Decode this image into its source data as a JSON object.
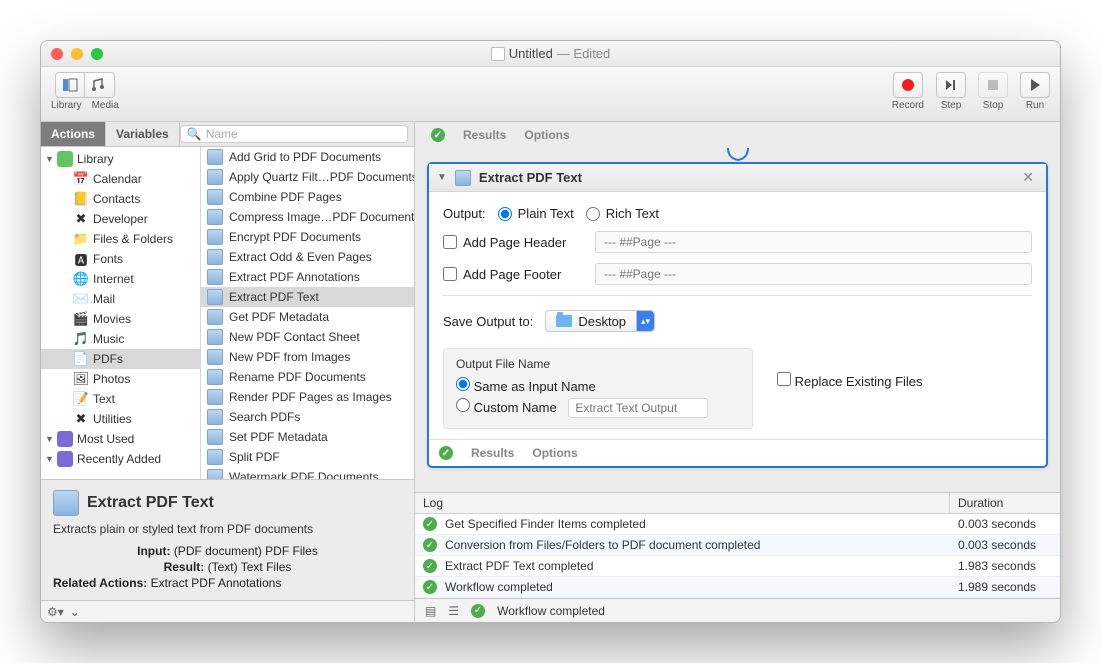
{
  "window": {
    "title": "Untitled",
    "edited": "— Edited"
  },
  "toolbar": {
    "library": "Library",
    "media": "Media",
    "record": "Record",
    "step": "Step",
    "stop": "Stop",
    "run": "Run"
  },
  "sidebar": {
    "tabs": {
      "actions": "Actions",
      "variables": "Variables"
    },
    "search_placeholder": "Name",
    "tree": [
      {
        "label": "Library",
        "icon": "lib",
        "root": true
      },
      {
        "label": "Calendar",
        "icon": "cal"
      },
      {
        "label": "Contacts",
        "icon": "con"
      },
      {
        "label": "Developer",
        "icon": "dev"
      },
      {
        "label": "Files & Folders",
        "icon": "fold"
      },
      {
        "label": "Fonts",
        "icon": "font"
      },
      {
        "label": "Internet",
        "icon": "net"
      },
      {
        "label": "Mail",
        "icon": "mail"
      },
      {
        "label": "Movies",
        "icon": "mov"
      },
      {
        "label": "Music",
        "icon": "mus"
      },
      {
        "label": "PDFs",
        "icon": "pdf",
        "selected": true
      },
      {
        "label": "Photos",
        "icon": "pho"
      },
      {
        "label": "Text",
        "icon": "txt"
      },
      {
        "label": "Utilities",
        "icon": "util"
      },
      {
        "label": "Most Used",
        "icon": "most",
        "root": true
      },
      {
        "label": "Recently Added",
        "icon": "rec",
        "root": true
      }
    ],
    "actions": [
      "Add Grid to PDF Documents",
      "Apply Quartz Filt…PDF Documents",
      "Combine PDF Pages",
      "Compress Image…PDF Documents",
      "Encrypt PDF Documents",
      "Extract Odd & Even Pages",
      "Extract PDF Annotations",
      "Extract PDF Text",
      "Get PDF Metadata",
      "New PDF Contact Sheet",
      "New PDF from Images",
      "Rename PDF Documents",
      "Render PDF Pages as Images",
      "Search PDFs",
      "Set PDF Metadata",
      "Split PDF",
      "Watermark PDF Documents"
    ],
    "selected_action_index": 7
  },
  "info": {
    "title": "Extract PDF Text",
    "desc": "Extracts plain or styled text from PDF documents",
    "input_label": "Input:",
    "input_val": "(PDF document) PDF Files",
    "result_label": "Result:",
    "result_val": "(Text) Text Files",
    "related_label": "Related Actions:",
    "related_val": "Extract PDF Annotations"
  },
  "card": {
    "title": "Extract PDF Text",
    "output_label": "Output:",
    "plain": "Plain Text",
    "rich": "Rich Text",
    "add_header": "Add Page Header",
    "header_ph": "--- ##Page ---",
    "add_footer": "Add Page Footer",
    "footer_ph": "--- ##Page ---",
    "save_to": "Save Output to:",
    "save_dest": "Desktop",
    "ofn": "Output File Name",
    "same": "Same as Input Name",
    "custom": "Custom Name",
    "custom_ph": "Extract Text Output",
    "replace": "Replace Existing Files",
    "results": "Results",
    "options": "Options"
  },
  "log": {
    "col1": "Log",
    "col2": "Duration",
    "rows": [
      {
        "msg": "Get Specified Finder Items completed",
        "dur": "0.003 seconds"
      },
      {
        "msg": "Conversion from Files/Folders to PDF document completed",
        "dur": "0.003 seconds"
      },
      {
        "msg": "Extract PDF Text completed",
        "dur": "1.983 seconds"
      },
      {
        "msg": "Workflow completed",
        "dur": "1.989 seconds"
      }
    ]
  },
  "status": "Workflow completed"
}
